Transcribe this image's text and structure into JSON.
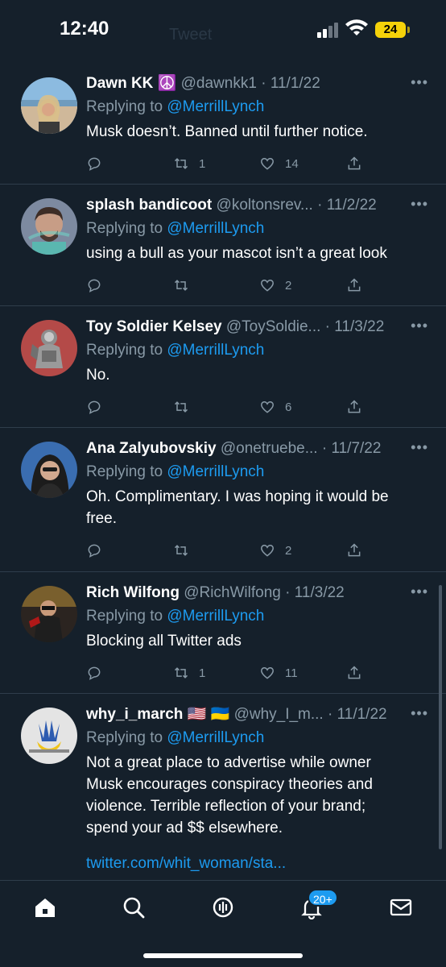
{
  "status_bar": {
    "time": "12:40",
    "battery": "24",
    "header_ghost_text": "Tweet"
  },
  "colors": {
    "background": "#15202b",
    "mention": "#1d9bf0",
    "muted": "#8899a6",
    "battery": "#f5d20a"
  },
  "replying_prefix": "Replying to ",
  "replies": [
    {
      "name": "Dawn KK",
      "emoji": "☮️",
      "handle": "@dawnkk1",
      "date": "11/1/22",
      "mention": "@MerrillLynch",
      "text": [
        "Musk doesn’t. Banned until further notice."
      ],
      "retweets": "1",
      "likes": "14"
    },
    {
      "name": "splash bandicoot",
      "emoji": "",
      "handle": "@koltonsrev...",
      "date": "11/2/22",
      "mention": "@MerrillLynch",
      "text": [
        "using a bull as your mascot isn’t a great look"
      ],
      "retweets": "",
      "likes": "2"
    },
    {
      "name": "Toy Soldier Kelsey",
      "emoji": "",
      "handle": "@ToySoldie...",
      "date": "11/3/22",
      "mention": "@MerrillLynch",
      "text": [
        "No."
      ],
      "retweets": "",
      "likes": "6"
    },
    {
      "name": "Ana Zalyubovskiy",
      "emoji": "",
      "handle": "@onetruebe...",
      "date": "11/7/22",
      "mention": "@MerrillLynch",
      "text": [
        "Oh. Complimentary. I was hoping it would be",
        "free."
      ],
      "retweets": "",
      "likes": "2"
    },
    {
      "name": "Rich Wilfong",
      "emoji": "",
      "handle": "@RichWilfong",
      "date": "11/3/22",
      "mention": "@MerrillLynch",
      "text": [
        "Blocking all Twitter ads"
      ],
      "retweets": "1",
      "likes": "11"
    },
    {
      "name": "why_i_march",
      "emoji": "🇺🇸 🇺🇦",
      "handle": "@why_I_m...",
      "date": "11/1/22",
      "mention": "@MerrillLynch",
      "text": [
        "Not a great place to advertise while owner",
        "Musk encourages conspiracy theories and",
        "violence.  Terrible reflection of your brand;",
        "spend your ad $$ elsewhere."
      ],
      "link": "twitter.com/whit_woman/sta..."
    }
  ],
  "tab_bar": {
    "icons": [
      "home-icon",
      "search-icon",
      "spaces-icon",
      "notifications-icon",
      "messages-icon"
    ],
    "notifications_badge": "20+"
  }
}
